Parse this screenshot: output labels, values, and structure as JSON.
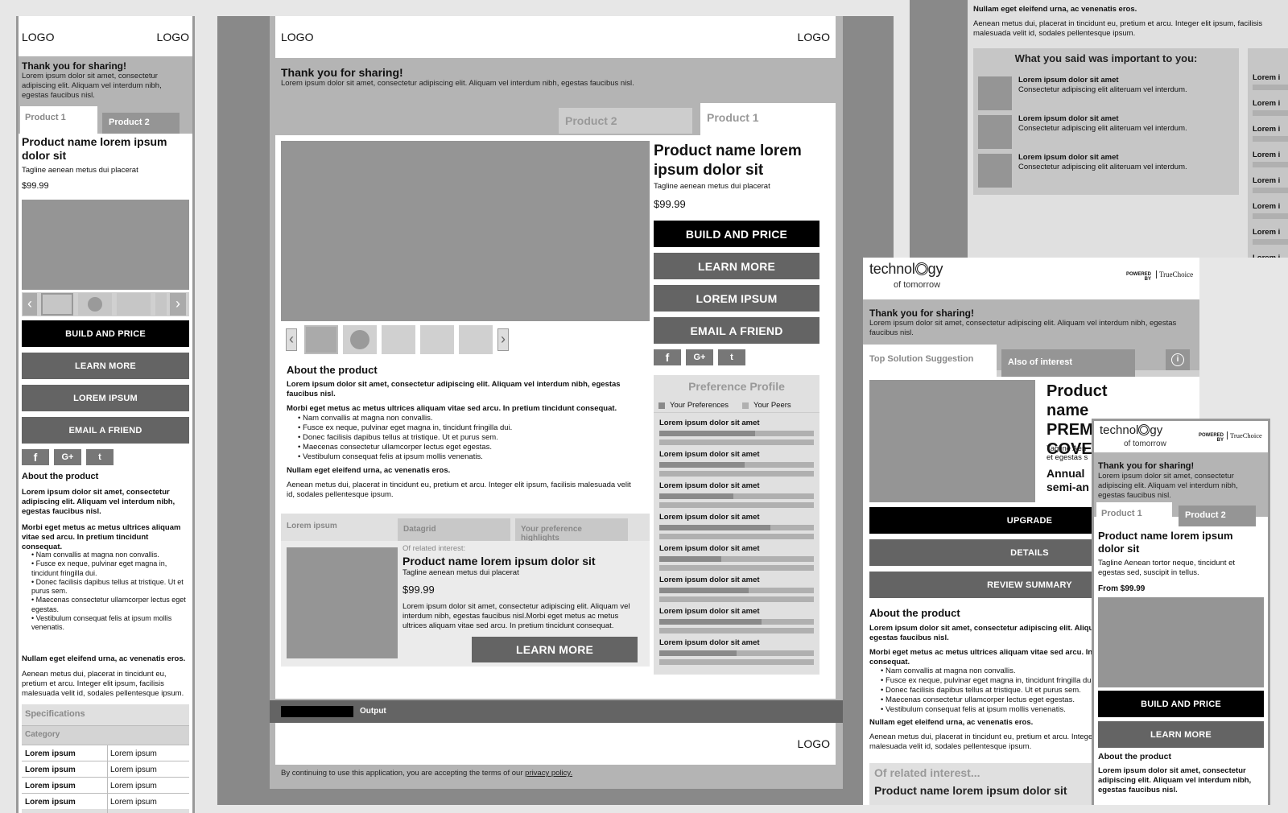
{
  "logo": "LOGO",
  "thanks": {
    "title": "Thank you for sharing!",
    "body": "Lorem ipsum dolor sit amet, consectetur adipiscing elit. Aliquam vel interdum nibh, egestas faucibus nisl."
  },
  "tabs": {
    "product1": "Product 1",
    "product2": "Product 2"
  },
  "product": {
    "name": "Product name lorem ipsum dolor sit",
    "tagline": "Tagline aenean metus dui placerat",
    "price": "$99.99"
  },
  "buttons": {
    "build": "BUILD AND PRICE",
    "learn": "LEARN MORE",
    "lorem": "LOREM IPSUM",
    "email": "EMAIL A FRIEND"
  },
  "about": {
    "heading": "About the product",
    "p1": "Lorem ipsum dolor sit amet, consectetur adipiscing elit. Aliquam vel interdum nibh, egestas faucibus nisl.",
    "p2": "Morbi eget metus ac metus ultrices aliquam vitae sed arcu. In pretium tincidunt consequat.",
    "bullets": [
      "Nam convallis at magna non convallis.",
      "Fusce ex neque, pulvinar eget magna in, tincidunt fringilla dui.",
      "Donec facilisis dapibus tellus at tristique. Ut et purus sem.",
      "Maecenas consectetur ullamcorper lectus eget egestas.",
      "Vestibulum consequat felis at ipsum mollis venenatis."
    ],
    "p3": "Nullam eget eleifend urna, ac venenatis eros.",
    "p4": "Aenean metus dui, placerat in tincidunt eu, pretium et arcu. Integer elit ipsum, facilisis malesuada velit id, sodales pellentesque ipsum."
  },
  "specs": {
    "title": "Specifications",
    "category": "Category",
    "cell": "Lorem ipsum"
  },
  "subtabs": {
    "a": "Lorem ipsum",
    "b": "Datagrid",
    "c": "Your preference highlights"
  },
  "related": {
    "label": "Of related interest:",
    "name": "Product name lorem ipsum dolor sit",
    "tagline": "Tagline aenean metus dui placerat",
    "price": "$99.99",
    "body": "Lorem ipsum dolor sit amet, consectetur adipiscing elit. Aliquam vel interdum nibh, egestas faucibus nisl.Morbi eget metus ac metus ultrices aliquam vitae sed arcu. In pretium tincidunt consequat.",
    "button": "LEARN MORE"
  },
  "pref": {
    "title": "Preference Profile",
    "yours": "Your Preferences",
    "peers": "Your Peers",
    "item": "Lorem ipsum dolor sit amet",
    "values": [
      [
        0.62,
        0.45
      ],
      [
        0.55,
        0.7
      ],
      [
        0.48,
        0.38
      ],
      [
        0.72,
        0.5
      ],
      [
        0.4,
        0.66
      ],
      [
        0.58,
        0.44
      ],
      [
        0.66,
        0.52
      ],
      [
        0.5,
        0.6
      ]
    ]
  },
  "output_label": "Output",
  "footer": {
    "text": "By continuing to use this application, you are accepting the terms of our ",
    "link": "privacy policy."
  },
  "top_right": {
    "line1": "Nullam eget eleifend urna, ac venenatis eros.",
    "line2": "Aenean metus dui, placerat in tincidunt eu, pretium et arcu. Integer elit ipsum, facilisis malesuada velit id, sodales pellentesque ipsum.",
    "important_title": "What you said was important to you:",
    "imp_head": "Lorem ipsum dolor sit amet",
    "imp_body": "Consectetur adipiscing elit aliteruam vel interdum.",
    "side_item": "Lorem i"
  },
  "brand": {
    "name_a": "technol",
    "name_b": "gy",
    "tag": "of tomorrow",
    "powered": "POWERED BY",
    "tc": "TrueChoice"
  },
  "tablet": {
    "tab_top": "Top Solution Suggestion",
    "tab_also": "Also of interest",
    "info": "i",
    "pname": "Product name PREMIER COVE",
    "tagline": "Tagline Aen et egestas s",
    "annual": "Annual semi-an",
    "upgrade": "UPGRADE",
    "details": "DETAILS",
    "review": "REVIEW SUMMARY",
    "related": "Of related interest...",
    "related_cut": "Product name lorem ipsum dolor sit"
  },
  "phone2": {
    "tagline": "Tagline Aenean tortor neque, tincidunt et egestas sed, suscipit in tellus.",
    "price": "From $99.99"
  },
  "colors": {
    "black": "#000000",
    "dark": "#646464",
    "mid": "#959595",
    "light": "#b4b4b4",
    "frame": "#898989"
  }
}
